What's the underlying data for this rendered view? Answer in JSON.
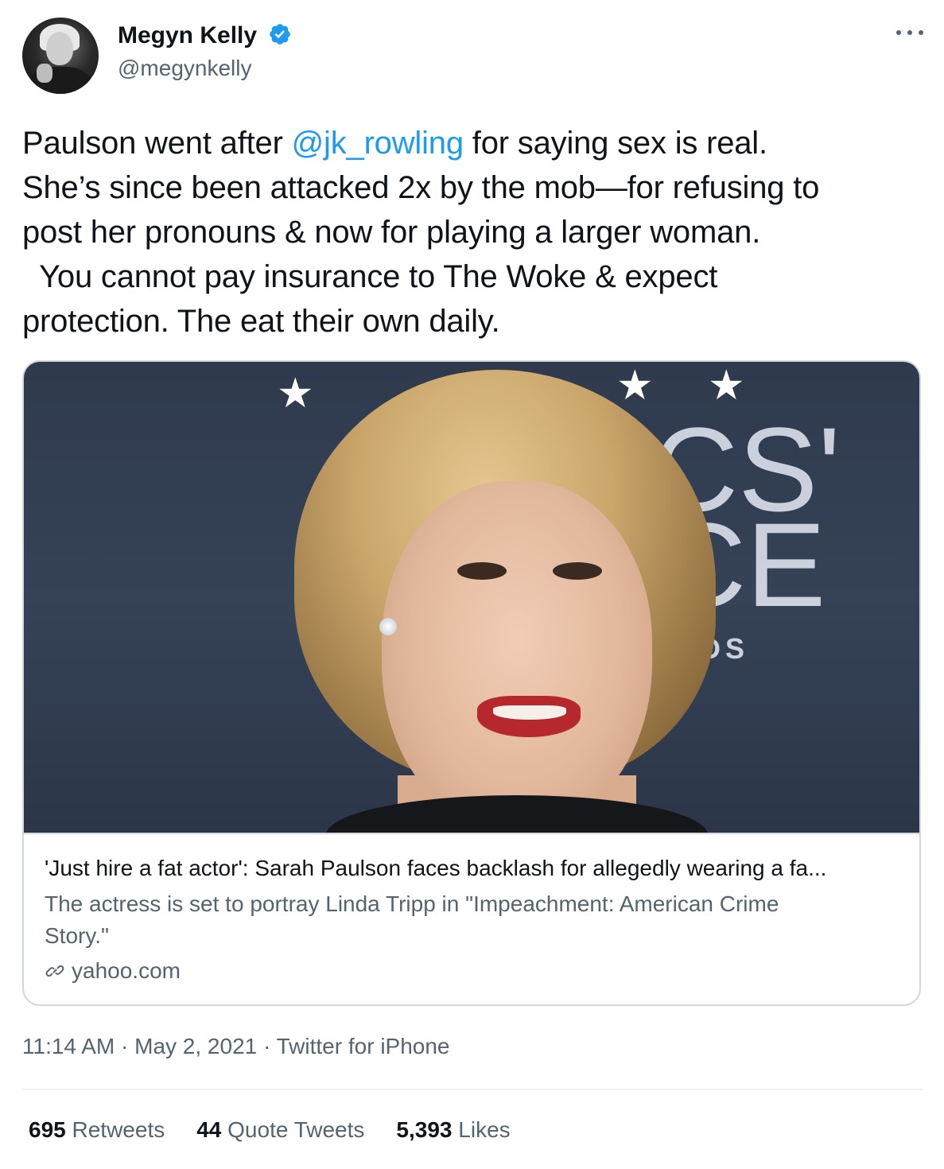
{
  "author": {
    "display_name": "Megyn Kelly",
    "handle": "@megynkelly",
    "verified": true,
    "avatar_icon": "avatar-photo"
  },
  "tweet": {
    "lines": [
      {
        "before": "Paulson went after ",
        "mention": "@jk_rowling",
        "after": " for saying sex is real."
      },
      {
        "text": "She’s since been attacked 2x by the mob—for refusing to"
      },
      {
        "text": "post her pronouns & now for playing a larger woman."
      },
      {
        "text": "  You cannot pay insurance to The Woke & expect"
      },
      {
        "text": "protection. The eat their own daily."
      }
    ]
  },
  "card": {
    "image_backdrop": {
      "letters_top": "CS'",
      "letters_mid": "CE",
      "letters_bottom": "DS"
    },
    "title": "'Just hire a fat actor': Sarah Paulson faces backlash for allegedly wearing a fa...",
    "description_lines": [
      "The actress is set to portray Linda Tripp in \"Impeachment: American Crime",
      "Story.\""
    ],
    "domain": "yahoo.com"
  },
  "meta": {
    "time": "11:14 AM",
    "date": "May 2, 2021",
    "source": "Twitter for iPhone",
    "separator": "·"
  },
  "stats": {
    "retweets_count": "695",
    "retweets_label": "Retweets",
    "quotes_count": "44",
    "quotes_label": "Quote Tweets",
    "likes_count": "5,393",
    "likes_label": "Likes"
  },
  "colors": {
    "accent": "#1d9bf0",
    "text": "#0f1419",
    "secondary": "#536471",
    "border": "#cfd9de"
  }
}
